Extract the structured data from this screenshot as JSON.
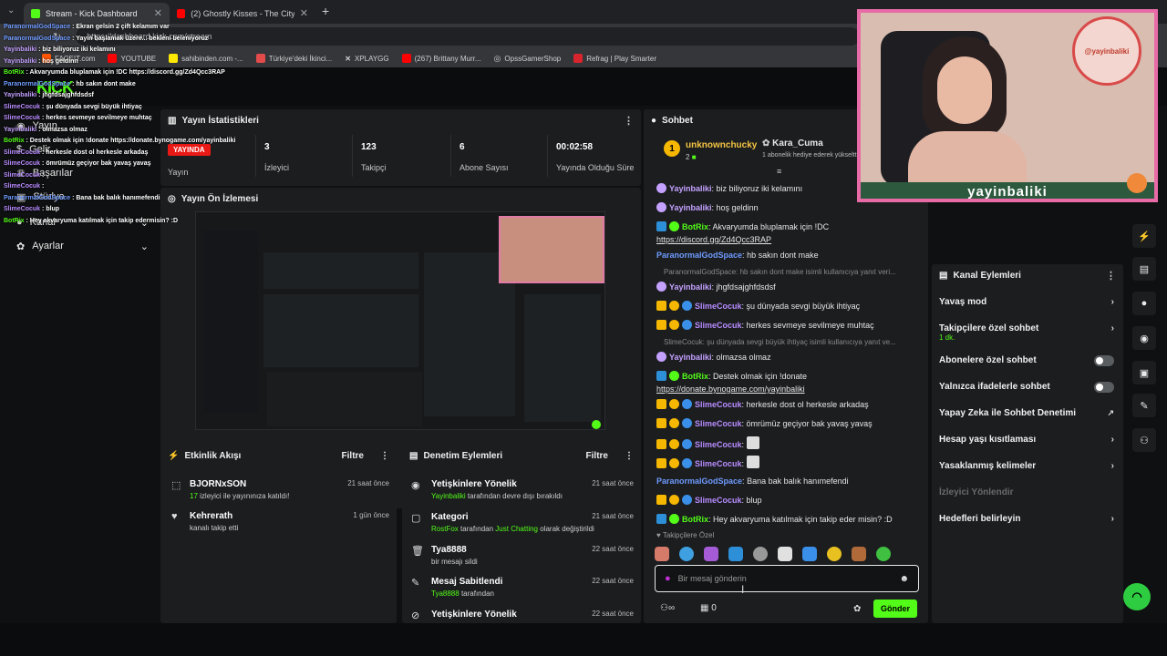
{
  "browser": {
    "tabs": [
      {
        "title": "Stream - Kick Dashboard"
      },
      {
        "title": "(2) Ghostly Kisses - The City H"
      }
    ],
    "url": "https://dashboard.kick.com/stream",
    "bookmarks": [
      "FACEIT.com",
      "YOUTUBE",
      "sahibinden.com -...",
      "Türkiye'deki İkinci...",
      "XPLAYGG",
      "(267) Brittany Murr...",
      "OpssGamerShop",
      "Refrag | Play Smarter"
    ]
  },
  "sidebar": {
    "items": [
      {
        "label": "Yayın"
      },
      {
        "label": "Gelir"
      },
      {
        "label": "Başarılar"
      },
      {
        "label": "Stüdyo"
      },
      {
        "label": "Kanal"
      },
      {
        "label": "Ayarlar"
      }
    ]
  },
  "stats": {
    "title": "Yayın İstatistikleri",
    "live_badge": "YAYINDA",
    "stream_label": "Yayın",
    "items": [
      {
        "value": "3",
        "label": "İzleyici"
      },
      {
        "value": "123",
        "label": "Takipçi"
      },
      {
        "value": "6",
        "label": "Abone Sayısı"
      },
      {
        "value": "00:02:58",
        "label": "Yayında Olduğu Süre"
      }
    ]
  },
  "preview": {
    "title": "Yayın Ön İzlemesi"
  },
  "activity": {
    "title": "Etkinlik Akışı",
    "filter": "Filtre",
    "items": [
      {
        "name": "BJORNxSON",
        "count": "17",
        "desc": "izleyici ile yayınınıza katıldı!",
        "time": "21 saat önce"
      },
      {
        "name": "Kehrerath",
        "desc": "kanalı takip etti",
        "time": "1 gün önce"
      }
    ]
  },
  "moderation": {
    "title": "Denetim Eylemleri",
    "filter": "Filtre",
    "items": [
      {
        "title": "Yetişkinlere Yönelik",
        "user": "Yayinbaliki",
        "desc": "tarafından devre dışı bırakıldı",
        "time": "21 saat önce"
      },
      {
        "title": "Kategori",
        "user": "RostFox",
        "desc": "tarafından",
        "extra": "Just Chatting",
        "desc2": "olarak değiştirildi",
        "time": "21 saat önce"
      },
      {
        "title": "Tya8888",
        "desc": "bir mesajı sildi",
        "time": "22 saat önce"
      },
      {
        "title": "Mesaj Sabitlendi",
        "user": "Tya8888",
        "desc": "tarafından",
        "time": "22 saat önce"
      },
      {
        "title": "Yetişkinlere Yönelik",
        "time": "22 saat önce"
      }
    ]
  },
  "chat": {
    "title": "Sohbet",
    "top_gifter": "unknownchucky",
    "top_gifter_count": "2",
    "gift_user": "Kara_Cuma",
    "gift_desc": "1 abonelik hediye ederek yükseltti",
    "messages": [
      {
        "user": "Yayinbaliki",
        "text": "biz biliyoruz iki kelamını",
        "color": "#c4a1ff"
      },
      {
        "user": "Yayinbaliki",
        "text": "hoş geldinn",
        "color": "#c4a1ff"
      },
      {
        "user": "BotRix",
        "text": "Akvaryumda bluplamak için !DC",
        "link": "https://discord.gg/Zd4Qcc3RAP",
        "color": "#53fc18"
      },
      {
        "user": "ParanormalGodSpace",
        "text": "hb sakın dont make",
        "color": "#6f9bff"
      },
      {
        "reply": "ParanormalGodSpace: hb sakın dont make isimli kullanıcıya yanıt veri..."
      },
      {
        "user": "Yayinbaliki",
        "text": "jhgfdsajghfdsdsf",
        "color": "#c4a1ff"
      },
      {
        "user": "SlimeCocuk",
        "text": "şu dünyada sevgi büyük ihtiyaç",
        "color": "#b88cff"
      },
      {
        "user": "SlimeCocuk",
        "text": "herkes sevmeye sevilmeye muhtaç",
        "color": "#b88cff"
      },
      {
        "reply": "SlimeCocuk: şu dünyada sevgi büyük ihtiyaç isimli kullanıcıya yanıt ve..."
      },
      {
        "user": "Yayinbaliki",
        "text": "olmazsa olmaz",
        "color": "#c4a1ff"
      },
      {
        "user": "BotRix",
        "text": "Destek olmak için !donate",
        "link": "https://donate.bynogame.com/yayinbaliki",
        "color": "#53fc18"
      },
      {
        "user": "SlimeCocuk",
        "text": "herkesle dost ol herkesle arkadaş",
        "color": "#b88cff"
      },
      {
        "user": "SlimeCocuk",
        "text": "ömrümüz geçiyor bak yavaş yavaş",
        "color": "#b88cff"
      },
      {
        "user": "SlimeCocuk",
        "text": "",
        "color": "#b88cff"
      },
      {
        "user": "SlimeCocuk",
        "text": "",
        "color": "#b88cff"
      },
      {
        "user": "ParanormalGodSpace",
        "text": "Bana bak balık hanımefendi",
        "color": "#6f9bff"
      },
      {
        "user": "SlimeCocuk",
        "text": "blup",
        "color": "#b88cff"
      },
      {
        "user": "BotRix",
        "text": "Hey akvaryuma katılmak için takip eder misin? :D",
        "color": "#53fc18"
      }
    ],
    "followers_label": "Takipçilere Özel",
    "input_placeholder": "Bir mesaj gönderin",
    "points": "0",
    "send_label": "Gönder"
  },
  "channel_actions": {
    "title": "Kanal Eylemleri",
    "items": [
      {
        "label": "Yavaş mod",
        "type": "chevron"
      },
      {
        "label": "Takipçilere özel sohbet",
        "sub": "1 dk.",
        "type": "chevron"
      },
      {
        "label": "Abonelere özel sohbet",
        "type": "toggle"
      },
      {
        "label": "Yalnızca ifadelerle sohbet",
        "type": "toggle"
      },
      {
        "label": "Yapay Zeka ile Sohbet Denetimi",
        "type": "external"
      },
      {
        "label": "Hesap yaşı kısıtlaması",
        "type": "chevron"
      },
      {
        "label": "Yasaklanmış kelimeler",
        "type": "chevron"
      },
      {
        "label": "İzleyici Yönlendir",
        "type": "disabled"
      },
      {
        "label": "Hedefleri belirleyin",
        "type": "chevron"
      }
    ]
  },
  "webcam": {
    "name": "yayinbaliki",
    "logo_text": "@yayinbaliki"
  },
  "overlay_chat": [
    {
      "user": "ParanormalGodSpace",
      "text": "Ekran gelsin 2 çift kelamım var"
    },
    {
      "user": "ParanormalGodSpace",
      "text": "Yayın başlamak üzere... bekleni beleniyoruz"
    },
    {
      "user": "Yayinbaliki",
      "text": "biz biliyoruz iki kelamını"
    },
    {
      "user": "Yayinbaliki",
      "text": "hoş geldinn"
    },
    {
      "user": "BotRix",
      "text": "Akvaryumda bluplamak için !DC https://discord.gg/Zd4Qcc3RAP"
    },
    {
      "user": "ParanormalGodSpace",
      "text": "hb sakın dont make"
    },
    {
      "user": "Yayinbaliki",
      "text": "jhgfdsajghfdsdsf"
    },
    {
      "user": "SlimeCocuk",
      "text": "şu dünyada sevgi büyük ihtiyaç"
    },
    {
      "user": "SlimeCocuk",
      "text": "herkes sevmeye sevilmeye muhtaç"
    },
    {
      "user": "Yayinbaliki",
      "text": "olmazsa olmaz"
    },
    {
      "user": "BotRix",
      "text": "Destek olmak için !donate https://donate.bynogame.com/yayinbaliki"
    },
    {
      "user": "SlimeCocuk",
      "text": "herkesle dost ol herkesle arkadaş"
    },
    {
      "user": "SlimeCocuk",
      "text": "ömrümüz geçiyor bak yavaş yavaş"
    },
    {
      "user": "SlimeCocuk",
      "text": ""
    },
    {
      "user": "SlimeCocuk",
      "text": ""
    },
    {
      "user": "ParanormalGodSpace",
      "text": "Bana bak balık hanımefendi"
    },
    {
      "user": "SlimeCocuk",
      "text": "blup"
    },
    {
      "user": "BotRix",
      "text": "Hey akvaryuma katılmak için takip edermisin? :D"
    }
  ],
  "colors": {
    "accent": "#53fc18",
    "panel": "#1b1d1f",
    "live": "#e91916"
  }
}
